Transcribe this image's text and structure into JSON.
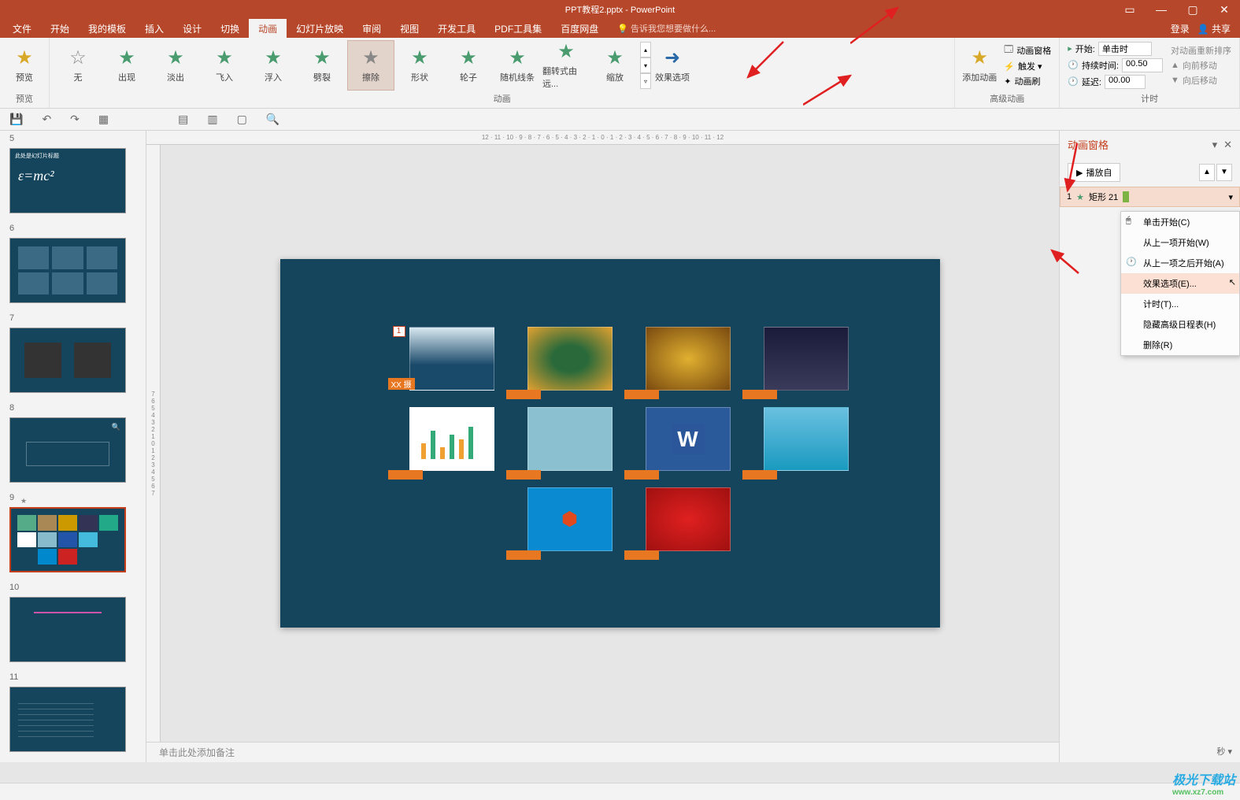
{
  "title": "PPT教程2.pptx - PowerPoint",
  "menus": {
    "file": "文件",
    "home": "开始",
    "template": "我的模板",
    "insert": "插入",
    "design": "设计",
    "transition": "切换",
    "animation": "动画",
    "slideshow": "幻灯片放映",
    "review": "审阅",
    "view": "视图",
    "devtools": "开发工具",
    "pdf": "PDF工具集",
    "baidu": "百度网盘"
  },
  "tellme": "告诉我您想要做什么...",
  "login": "登录",
  "share": "共享",
  "ribbon": {
    "preview": "预览",
    "previewGroup": "预览",
    "none": "无",
    "appear": "出现",
    "fade": "淡出",
    "flyin": "飞入",
    "float": "浮入",
    "split": "劈裂",
    "wipe": "擦除",
    "shape": "形状",
    "wheel": "轮子",
    "random": "随机线条",
    "spin": "翻转式由远...",
    "zoom": "缩放",
    "animationGroup": "动画",
    "effectOptions": "效果选项",
    "addAnim": "添加动画",
    "animPane": "动画窗格",
    "trigger": "触发 ▾",
    "animPainter": "动画刷",
    "advGroup": "高级动画",
    "start": "开始:",
    "startVal": "单击时",
    "duration": "持续时间:",
    "durationVal": "00.50",
    "delay": "延迟:",
    "delayVal": "00.00",
    "reorder": "对动画重新排序",
    "moveEarlier": "向前移动",
    "moveLater": "向后移动",
    "timingGroup": "计时"
  },
  "animPane": {
    "title": "动画窗格",
    "play": "播放自",
    "itemNum": "1",
    "itemShape": "矩形 21",
    "seconds": "秒 ▾"
  },
  "ctx": {
    "onClick": "单击开始(C)",
    "withPrev": "从上一项开始(W)",
    "afterPrev": "从上一项之后开始(A)",
    "effect": "效果选项(E)...",
    "timing": "计时(T)...",
    "hideAdv": "隐藏高级日程表(H)",
    "remove": "删除(R)"
  },
  "thumbs": {
    "n5": "5",
    "n6": "6",
    "n7": "7",
    "n8": "8",
    "n9": "9",
    "n10": "10",
    "n11": "11"
  },
  "slide5label": "此处是幻灯片标题",
  "formula": "ε=mc²",
  "notes": "单击此处添加备注",
  "xxshe": "XX 摄",
  "ruler": "12 · 11 · 10 · 9 · 8 · 7 · 6 · 5 · 4 · 3 · 2 · 1 · 0 · 1 · 2 · 3 · 4 · 5 · 6 · 7 · 8 · 9 · 10 · 11 · 12",
  "rulerV": "7 6 5 4 3 2 1 0 1 2 3 4 5 6 7",
  "watermark": "极光下载站",
  "watermarkUrl": "www.xz7.com"
}
